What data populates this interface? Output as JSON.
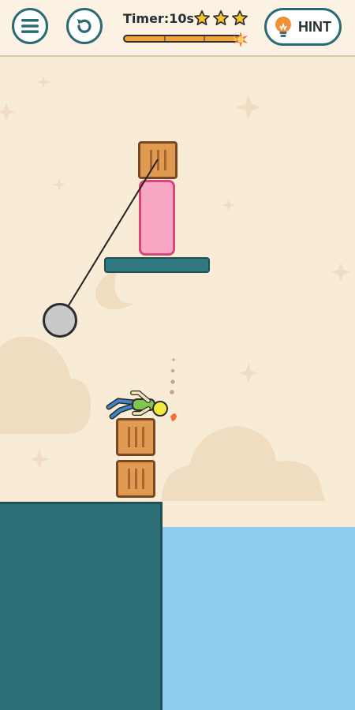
{
  "hud": {
    "menu_icon": "menu-icon",
    "restart_icon": "restart-icon",
    "timer_label": "Timer:10s",
    "timer_progress": 0.95,
    "stars": 3,
    "hint_label": "HINT",
    "hint_icon": "lightbulb-icon"
  },
  "colors": {
    "accent": "#2a6a73",
    "sky": "#f8ecd7",
    "water": "#8ecbef",
    "cliff": "#2e6e76",
    "star": "#f4c430",
    "hint_bulb": "#f0913a"
  }
}
